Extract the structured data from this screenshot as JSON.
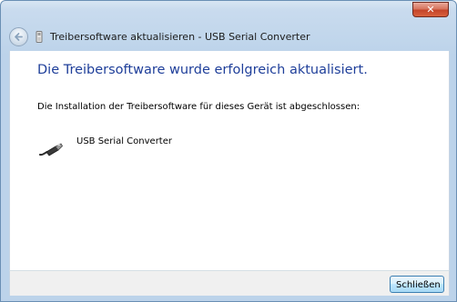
{
  "window": {
    "close_symbol": "✕",
    "title": "Treibersoftware aktualisieren - USB Serial Converter",
    "back_icon": "back-arrow-icon",
    "title_icon": "usb-device-icon"
  },
  "main": {
    "heading": "Die Treibersoftware wurde erfolgreich aktualisiert.",
    "description": "Die Installation der Treibersoftware für dieses Gerät ist abgeschlossen:",
    "device_icon": "usb-plug-icon",
    "device_name": "USB Serial Converter"
  },
  "footer": {
    "close_label": "Schließen"
  },
  "colors": {
    "heading": "#1f3f9a",
    "frame": "#bcd3ea",
    "close_button_red": "#c4452a"
  }
}
